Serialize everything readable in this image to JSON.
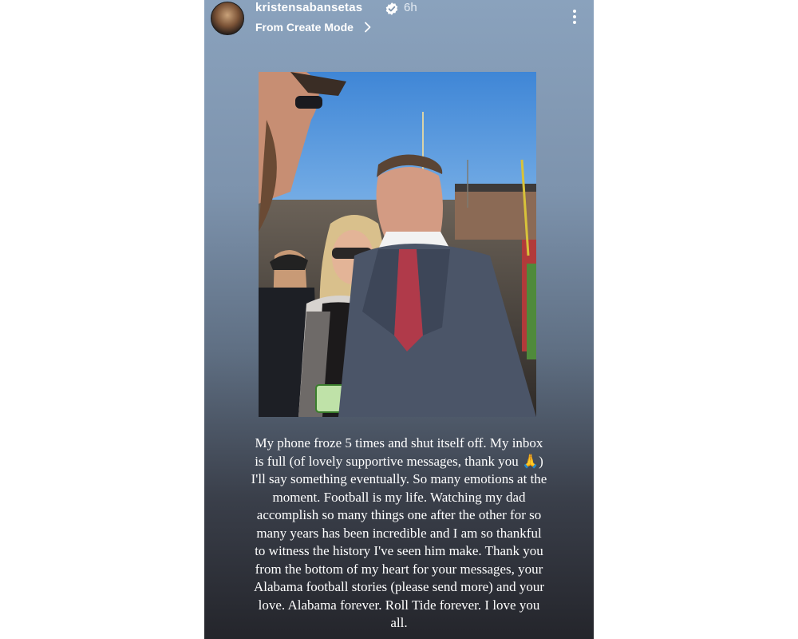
{
  "story": {
    "username": "kristensabansetas",
    "timestamp": "6h",
    "subtitle": "From Create Mode",
    "caption": "My phone froze 5 times and shut itself off. My inbox\nis full (of lovely supportive messages, thank you 🙏)\nI'll say something eventually. So many emotions at the\nmoment. Football is my life. Watching my dad\naccomplish so many things one after the other for so\nmany years has been incredible and I am so thankful\nto witness the history I've seen him make. Thank you\nfrom the bottom of my heart for your messages, your\nAlabama football stories (please send more) and your\nlove. Alabama forever. Roll Tide forever. I love you\nall."
  },
  "icons": {
    "verified": "verified-badge-icon",
    "chevron": "chevron-right-icon",
    "more": "more-options-icon"
  },
  "colors": {
    "verified_blue": "#3797f0",
    "background_top": "#8aa2bd",
    "background_bottom": "#24252b"
  }
}
